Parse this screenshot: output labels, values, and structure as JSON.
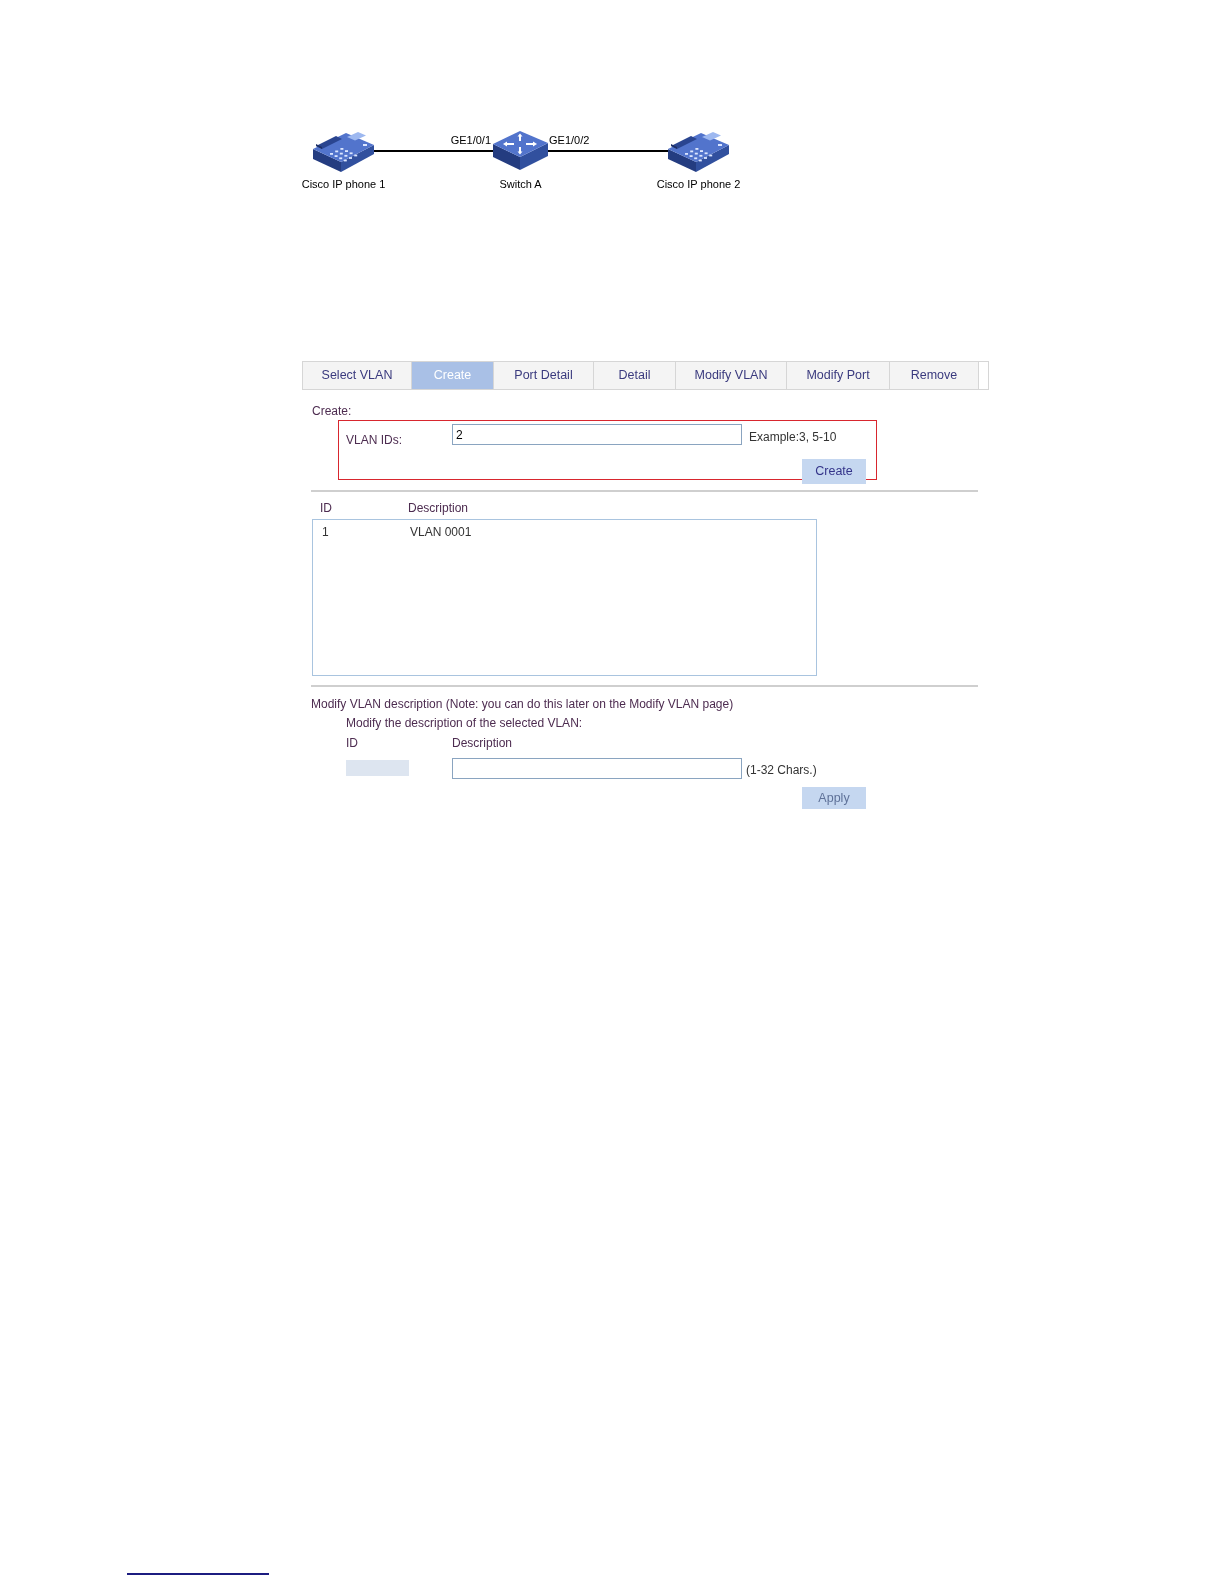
{
  "topology": {
    "nodes": [
      {
        "kind": "phone",
        "label": "Cisco IP phone 1"
      },
      {
        "kind": "switch",
        "label": "Switch A"
      },
      {
        "kind": "phone",
        "label": "Cisco IP phone 2"
      }
    ],
    "links": [
      {
        "port": "GE1/0/1"
      },
      {
        "port": "GE1/0/2"
      }
    ]
  },
  "tabs": [
    {
      "label": "Select VLAN",
      "selected": false
    },
    {
      "label": "Create",
      "selected": true
    },
    {
      "label": "Port Detail",
      "selected": false
    },
    {
      "label": "Detail",
      "selected": false
    },
    {
      "label": "Modify VLAN",
      "selected": false
    },
    {
      "label": "Modify Port",
      "selected": false
    },
    {
      "label": "Remove",
      "selected": false
    }
  ],
  "create": {
    "heading": "Create:",
    "vlan_ids": {
      "label": "VLAN IDs:",
      "value": "2"
    },
    "hint": "Example:3, 5-10",
    "button": {
      "label": "Create",
      "disabled": false
    }
  },
  "vlan_list": {
    "columns": [
      "ID",
      "Description"
    ],
    "rows": [
      {
        "id": "1",
        "description": "VLAN 0001",
        "selected": false
      }
    ]
  },
  "modify": {
    "heading": "Modify VLAN description (Note: you can do this later on the Modify VLAN page)",
    "instruction": "Modify the description of the selected VLAN:",
    "columns": [
      "ID",
      "Description"
    ],
    "id_field": {
      "disabled": true
    },
    "hint": "(1-32 Chars.)",
    "button": {
      "label": "Apply",
      "disabled": true
    }
  }
}
